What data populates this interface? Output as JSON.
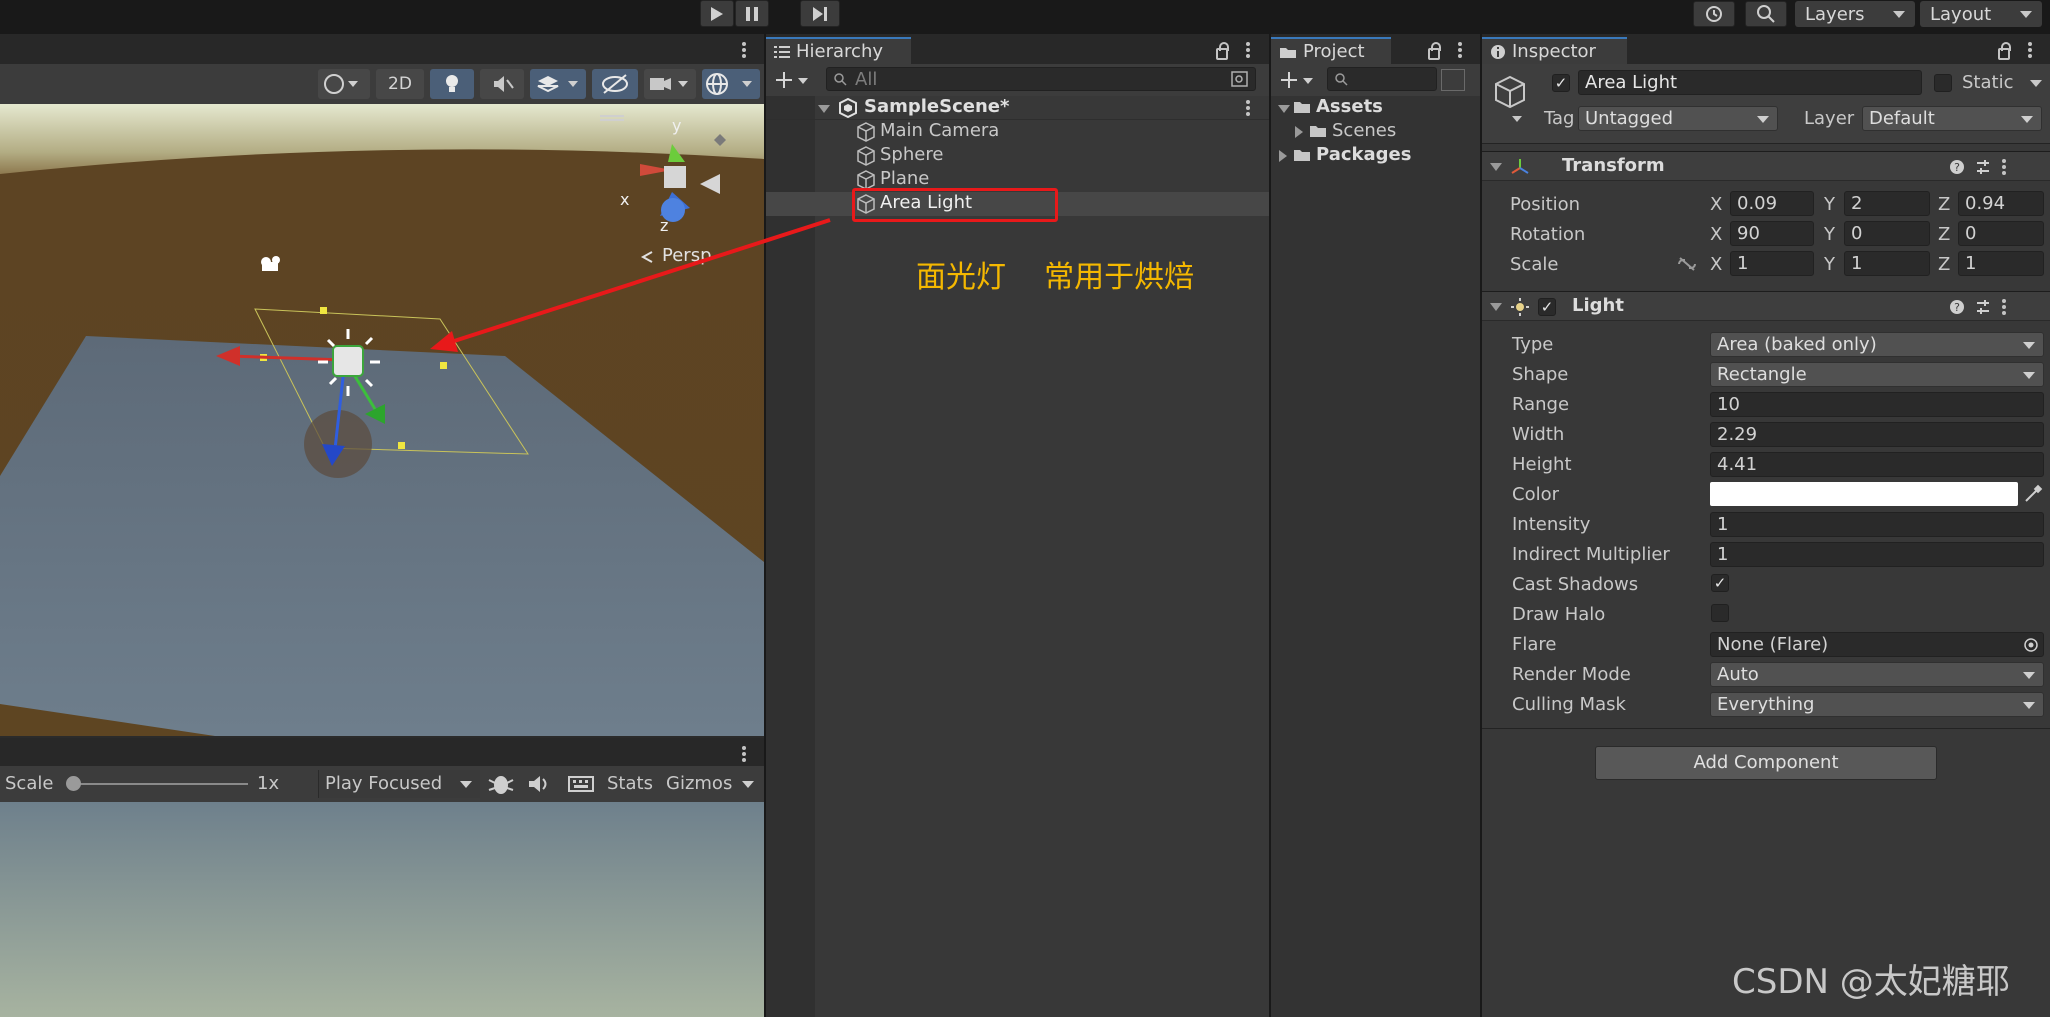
{
  "toolbar": {
    "layers_label": "Layers",
    "layout_label": "Layout"
  },
  "scene_view": {
    "toggle_2d": "2D",
    "gizmo_axis_x": "x",
    "gizmo_axis_y": "y",
    "gizmo_axis_z": "z",
    "persp_label": "Persp"
  },
  "game_view": {
    "scale_label": "Scale",
    "scale_value": "1x",
    "play_mode": "Play Focused",
    "stats_label": "Stats",
    "gizmos_label": "Gizmos"
  },
  "hierarchy": {
    "tab_label": "Hierarchy",
    "search_placeholder": "All",
    "scene_name": "SampleScene*",
    "items": [
      "Main Camera",
      "Sphere",
      "Plane",
      "Area Light"
    ],
    "annotation": "面光灯    常用于烘焙"
  },
  "project": {
    "tab_label": "Project",
    "tree": {
      "assets": "Assets",
      "scenes": "Scenes",
      "packages": "Packages"
    }
  },
  "inspector": {
    "tab_label": "Inspector",
    "object_name": "Area Light",
    "static_label": "Static",
    "tag_label": "Tag",
    "tag_value": "Untagged",
    "layer_label": "Layer",
    "layer_value": "Default",
    "transform": {
      "title": "Transform",
      "position_label": "Position",
      "rotation_label": "Rotation",
      "scale_label": "Scale",
      "position": {
        "x": "0.09",
        "y": "2",
        "z": "0.94"
      },
      "rotation": {
        "x": "90",
        "y": "0",
        "z": "0"
      },
      "scale": {
        "x": "1",
        "y": "1",
        "z": "1"
      },
      "axis_x": "X",
      "axis_y": "Y",
      "axis_z": "Z"
    },
    "light": {
      "title": "Light",
      "type_label": "Type",
      "type_value": "Area (baked only)",
      "shape_label": "Shape",
      "shape_value": "Rectangle",
      "range_label": "Range",
      "range_value": "10",
      "width_label": "Width",
      "width_value": "2.29",
      "height_label": "Height",
      "height_value": "4.41",
      "color_label": "Color",
      "color_value": "#ffffff",
      "intensity_label": "Intensity",
      "intensity_value": "1",
      "indirect_label": "Indirect Multiplier",
      "indirect_value": "1",
      "cast_shadows_label": "Cast Shadows",
      "cast_shadows": true,
      "draw_halo_label": "Draw Halo",
      "draw_halo": false,
      "flare_label": "Flare",
      "flare_value": "None (Flare)",
      "render_mode_label": "Render Mode",
      "render_mode_value": "Auto",
      "culling_mask_label": "Culling Mask",
      "culling_mask_value": "Everything"
    },
    "add_component": "Add Component"
  },
  "watermark": "CSDN @太妃糖耶",
  "colors": {
    "accent": "#3a79bb",
    "annotation": "#f5b800",
    "highlight_box": "#e8191a"
  }
}
